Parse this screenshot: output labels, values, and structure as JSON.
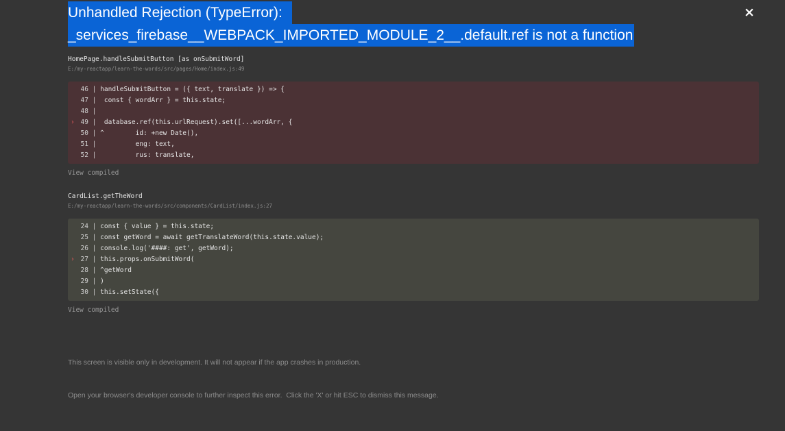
{
  "header": {
    "title_line1": "Unhandled Rejection (TypeError):",
    "title_line2": "_services_firebase__WEBPACK_IMPORTED_MODULE_2__.default.ref is not a function",
    "close_label": "×"
  },
  "frames": [
    {
      "function": "HomePage.handleSubmitButton [as onSubmitWord]",
      "path": "E:/my-reactapp/learn-the-words/src/pages/Home/index.js:49",
      "highlight_color": "#4b3235",
      "lines": [
        {
          "num": "46",
          "code": "handleSubmitButton = ({ text, translate }) => {",
          "active": false
        },
        {
          "num": "47",
          "code": " const { wordArr } = this.state;",
          "active": false
        },
        {
          "num": "48",
          "code": "",
          "active": false
        },
        {
          "num": "49",
          "code": " database.ref(this.urlRequest).set([...wordArr, {",
          "active": true
        },
        {
          "num": "50",
          "code": "^        id: +new Date(),",
          "active": false
        },
        {
          "num": "51",
          "code": "         eng: text,",
          "active": false
        },
        {
          "num": "52",
          "code": "         rus: translate,",
          "active": false
        }
      ],
      "view_compiled": "View compiled"
    },
    {
      "function": "CardList.getTheWord",
      "path": "E:/my-reactapp/learn-the-words/src/components/CardList/index.js:27",
      "highlight_color": "#45463f",
      "lines": [
        {
          "num": "24",
          "code": "const { value } = this.state;",
          "active": false
        },
        {
          "num": "25",
          "code": "const getWord = await getTranslateWord(this.state.value);",
          "active": false
        },
        {
          "num": "26",
          "code": "console.log('####: get', getWord);",
          "active": false
        },
        {
          "num": "27",
          "code": "this.props.onSubmitWord(",
          "active": true
        },
        {
          "num": "28",
          "code": "^getWord",
          "active": false
        },
        {
          "num": "29",
          "code": ")",
          "active": false
        },
        {
          "num": "30",
          "code": "this.setState({",
          "active": false
        }
      ],
      "view_compiled": "View compiled"
    }
  ],
  "footer": {
    "line1": "This screen is visible only in development. It will not appear if the app crashes in production.",
    "line2": "Open your browser's developer console to further inspect this error.  Click the 'X' or hit ESC to dismiss this message."
  },
  "markers": {
    "active_line": "›"
  }
}
